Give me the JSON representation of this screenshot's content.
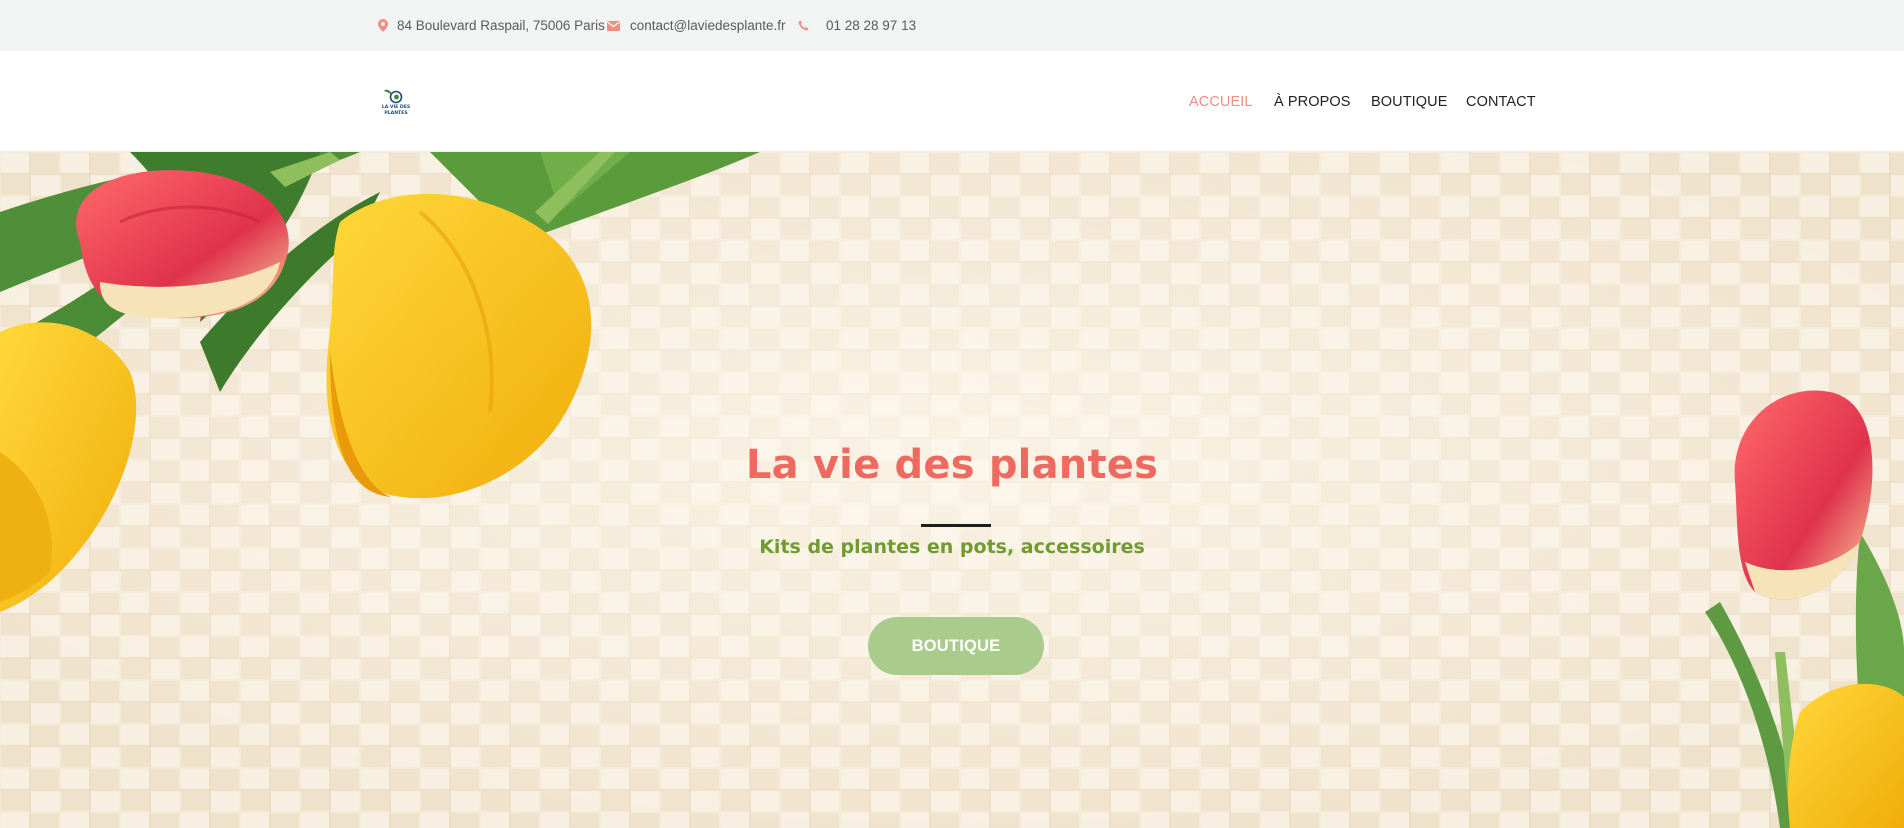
{
  "topbar": {
    "address": "84 Boulevard Raspail, 75006 Paris",
    "email": "contact@laviedesplante.fr",
    "phone": "01 28 28 97 13",
    "icons": [
      "map-marker-icon",
      "envelope-icon",
      "phone-icon"
    ],
    "icon_color": "#f28d86"
  },
  "header": {
    "logo_text": [
      "LA VIE DES",
      "PLANTES"
    ],
    "nav": [
      {
        "label": "ACCUEIL",
        "active": true
      },
      {
        "label": "À PROPOS",
        "active": false
      },
      {
        "label": "BOUTIQUE",
        "active": false
      },
      {
        "label": "CONTACT",
        "active": false
      }
    ],
    "active_color": "#f28d86"
  },
  "hero": {
    "title": "La vie des plantes",
    "subtitle": "Kits de plantes en pots, accessoires",
    "button_label": "BOUTIQUE",
    "title_color": "#ee6a60",
    "subtitle_color": "#6e9c2f",
    "button_color": "#a9cb8c"
  }
}
